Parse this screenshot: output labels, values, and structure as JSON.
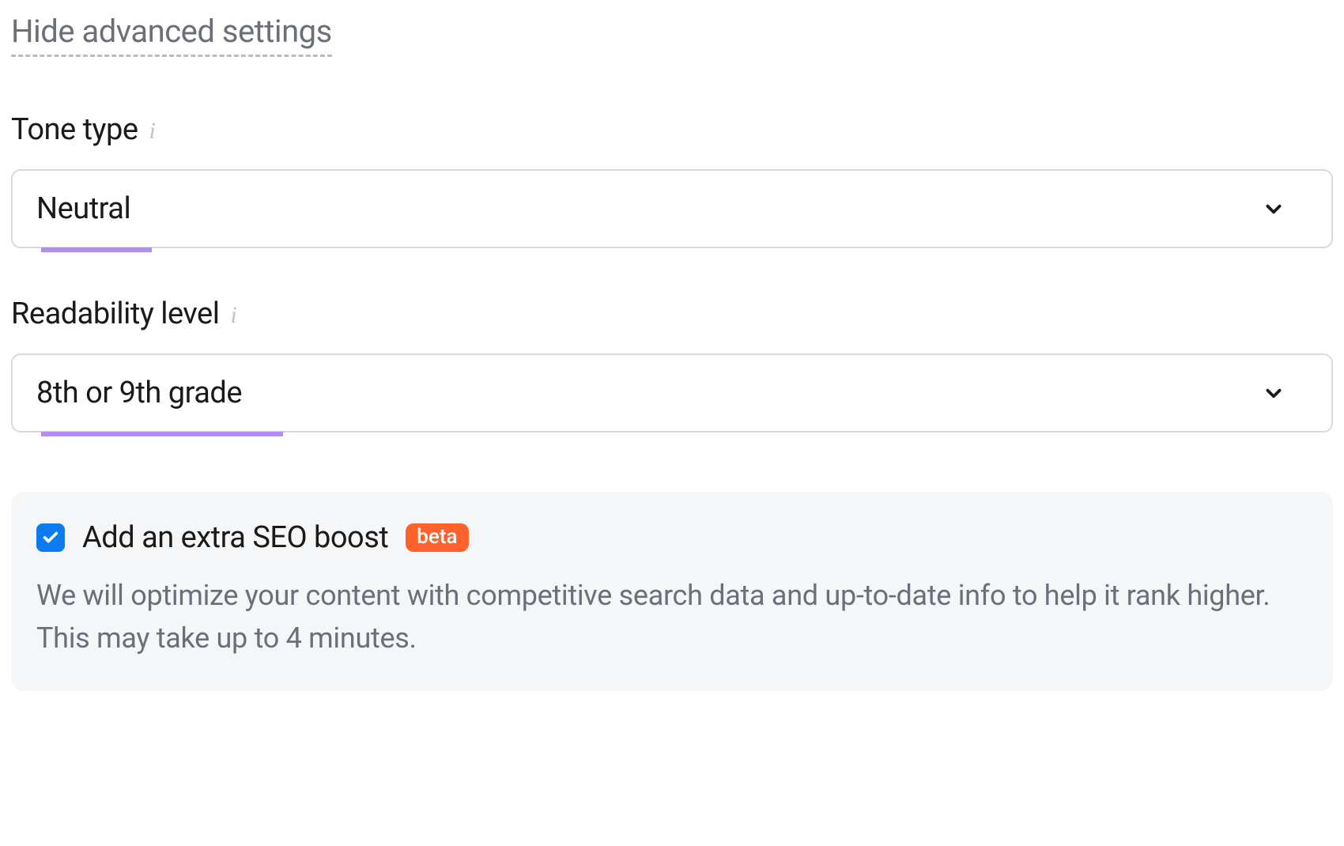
{
  "advanced": {
    "toggle_label": "Hide advanced settings"
  },
  "tone": {
    "label": "Tone type",
    "selected": "Neutral"
  },
  "readability": {
    "label": "Readability level",
    "selected": "8th or 9th grade"
  },
  "seo": {
    "checked": true,
    "title": "Add an extra SEO boost",
    "badge": "beta",
    "description": "We will optimize your content with competitive search data and up-to-date info to help it rank higher. This may take up to 4 minutes."
  }
}
